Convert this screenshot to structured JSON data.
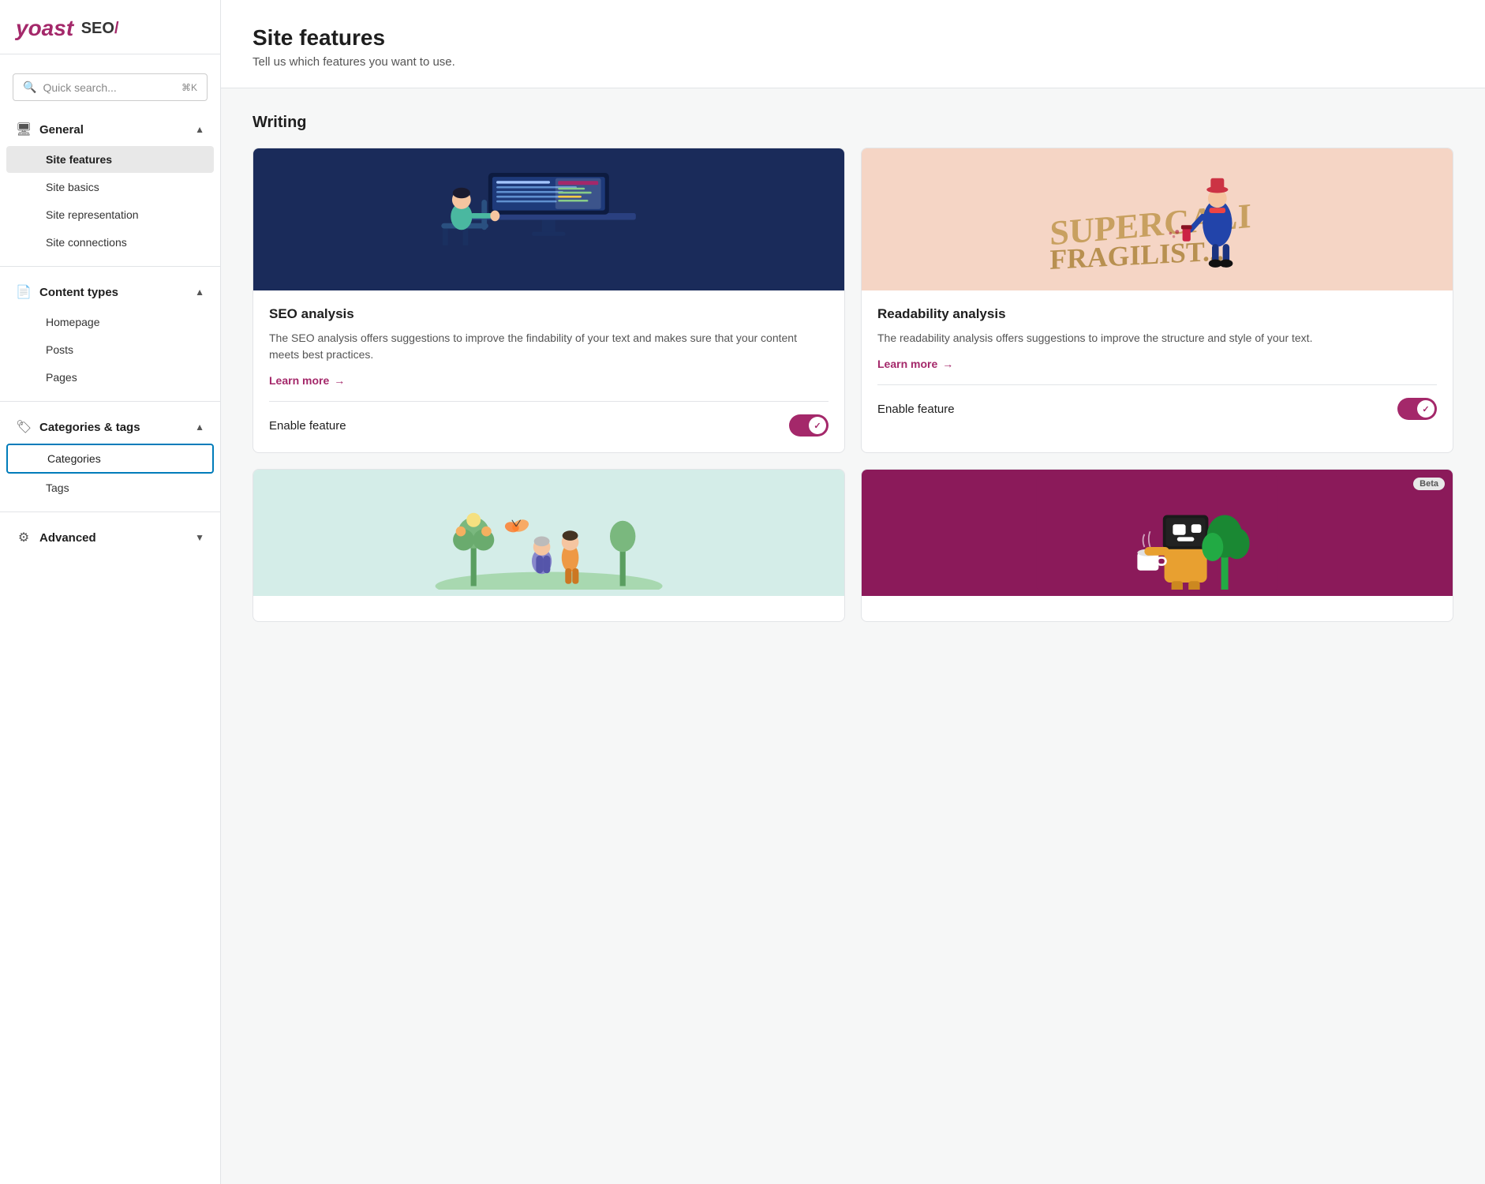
{
  "logo": {
    "yoast": "yoast",
    "seo": "SEO",
    "slash": "/"
  },
  "search": {
    "placeholder": "Quick search...",
    "shortcut": "⌘K"
  },
  "sidebar": {
    "sections": [
      {
        "id": "general",
        "icon": "🖥",
        "label": "General",
        "expanded": true,
        "items": [
          {
            "id": "site-features",
            "label": "Site features",
            "active": true,
            "selected": false
          },
          {
            "id": "site-basics",
            "label": "Site basics",
            "active": false,
            "selected": false
          },
          {
            "id": "site-representation",
            "label": "Site representation",
            "active": false,
            "selected": false
          },
          {
            "id": "site-connections",
            "label": "Site connections",
            "active": false,
            "selected": false
          }
        ]
      },
      {
        "id": "content-types",
        "icon": "📄",
        "label": "Content types",
        "expanded": true,
        "items": [
          {
            "id": "homepage",
            "label": "Homepage",
            "active": false,
            "selected": false
          },
          {
            "id": "posts",
            "label": "Posts",
            "active": false,
            "selected": false
          },
          {
            "id": "pages",
            "label": "Pages",
            "active": false,
            "selected": false
          }
        ]
      },
      {
        "id": "categories-tags",
        "icon": "🏷",
        "label": "Categories & tags",
        "expanded": true,
        "items": [
          {
            "id": "categories",
            "label": "Categories",
            "active": false,
            "selected": true
          },
          {
            "id": "tags",
            "label": "Tags",
            "active": false,
            "selected": false
          }
        ]
      },
      {
        "id": "advanced",
        "icon": "⚙",
        "label": "Advanced",
        "expanded": false,
        "items": []
      }
    ]
  },
  "page": {
    "title": "Site features",
    "subtitle": "Tell us which features you want to use."
  },
  "writing_section": {
    "title": "Writing",
    "cards": [
      {
        "id": "seo-analysis",
        "title": "SEO analysis",
        "description": "The SEO analysis offers suggestions to improve the findability of your text and makes sure that your content meets best practices.",
        "learn_more": "Learn more",
        "enable_label": "Enable feature",
        "enabled": true,
        "beta": false,
        "image_style": "blue"
      },
      {
        "id": "readability-analysis",
        "title": "Readability analysis",
        "description": "The readability analysis offers suggestions to improve the structure and style of your text.",
        "learn_more": "Learn more",
        "enable_label": "Enable feature",
        "enabled": true,
        "beta": false,
        "image_style": "peach"
      },
      {
        "id": "card-3",
        "title": "",
        "description": "",
        "learn_more": "",
        "enable_label": "",
        "enabled": false,
        "beta": false,
        "image_style": "mint"
      },
      {
        "id": "card-4",
        "title": "",
        "description": "",
        "learn_more": "",
        "enable_label": "",
        "enabled": false,
        "beta": true,
        "image_style": "purple"
      }
    ]
  }
}
